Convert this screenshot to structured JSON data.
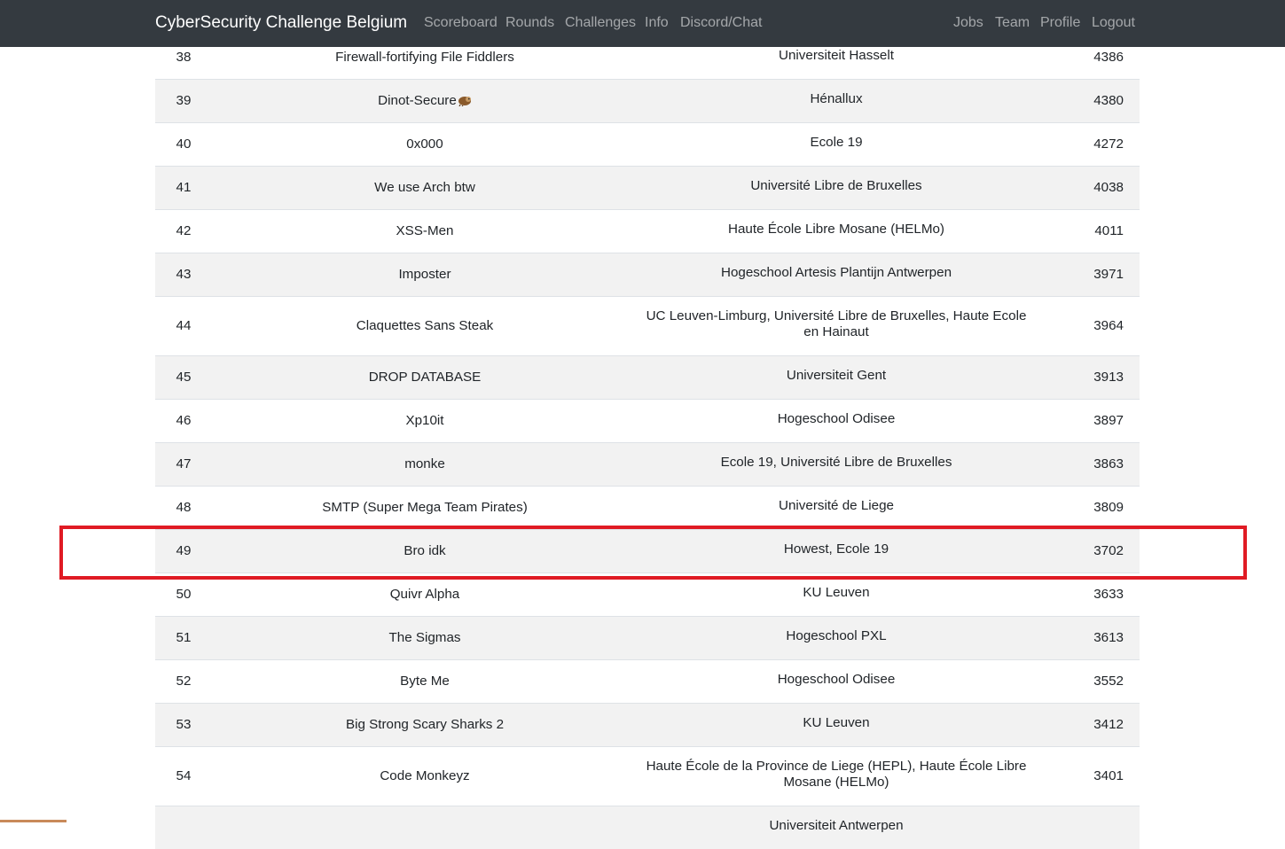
{
  "navbar": {
    "brand": "CyberSecurity Challenge Belgium",
    "left_links": [
      "Scoreboard",
      "Rounds",
      "Challenges",
      "Info",
      "Discord/Chat"
    ],
    "right_links": [
      "Jobs",
      "Team",
      "Profile",
      "Logout"
    ]
  },
  "scoreboard": {
    "rows": [
      {
        "rank": "38",
        "team": "Firewall-fortifying File Fiddlers",
        "university": "Universiteit Hasselt",
        "score": "4386"
      },
      {
        "rank": "39",
        "team": "Dinot-Secure",
        "team_emoji": "sloth-icon",
        "university": "Hénallux",
        "score": "4380"
      },
      {
        "rank": "40",
        "team": "0x000",
        "university": "Ecole 19",
        "score": "4272"
      },
      {
        "rank": "41",
        "team": "We use Arch btw",
        "university": "Université Libre de Bruxelles",
        "score": "4038"
      },
      {
        "rank": "42",
        "team": "XSS-Men",
        "university": "Haute École Libre Mosane (HELMo)",
        "score": "4011"
      },
      {
        "rank": "43",
        "team": "Imposter",
        "university": "Hogeschool Artesis Plantijn Antwerpen",
        "score": "3971"
      },
      {
        "rank": "44",
        "team": "Claquettes Sans Steak",
        "university": "UC Leuven-Limburg, Université Libre de Bruxelles, Haute Ecole en Hainaut",
        "score": "3964"
      },
      {
        "rank": "45",
        "team": "DROP DATABASE",
        "university": "Universiteit Gent",
        "score": "3913"
      },
      {
        "rank": "46",
        "team": "Xp10it",
        "university": "Hogeschool Odisee",
        "score": "3897"
      },
      {
        "rank": "47",
        "team": "monke",
        "university": "Ecole 19, Université Libre de Bruxelles",
        "score": "3863"
      },
      {
        "rank": "48",
        "team": "SMTP (Super Mega Team Pirates)",
        "university": "Université de Liege",
        "score": "3809"
      },
      {
        "rank": "49",
        "team": "Bro idk",
        "university": "Howest, Ecole 19",
        "score": "3702"
      },
      {
        "rank": "50",
        "team": "Quivr Alpha",
        "university": "KU Leuven",
        "score": "3633"
      },
      {
        "rank": "51",
        "team": "The Sigmas",
        "university": "Hogeschool PXL",
        "score": "3613"
      },
      {
        "rank": "52",
        "team": "Byte Me",
        "university": "Hogeschool Odisee",
        "score": "3552"
      },
      {
        "rank": "53",
        "team": "Big Strong Scary Sharks 2",
        "university": "KU Leuven",
        "score": "3412"
      },
      {
        "rank": "54",
        "team": "Code Monkeyz",
        "university": "Haute École de la Province de Liege (HEPL), Haute École Libre Mosane (HELMo)",
        "score": "3401"
      },
      {
        "rank": "",
        "team": "",
        "university": "Universiteit Antwerpen",
        "score": ""
      }
    ],
    "highlighted_rank": "49"
  },
  "colors": {
    "navbar_bg": "#343a40",
    "highlight_border": "#e01b24",
    "stripe": "#f2f2f2"
  }
}
